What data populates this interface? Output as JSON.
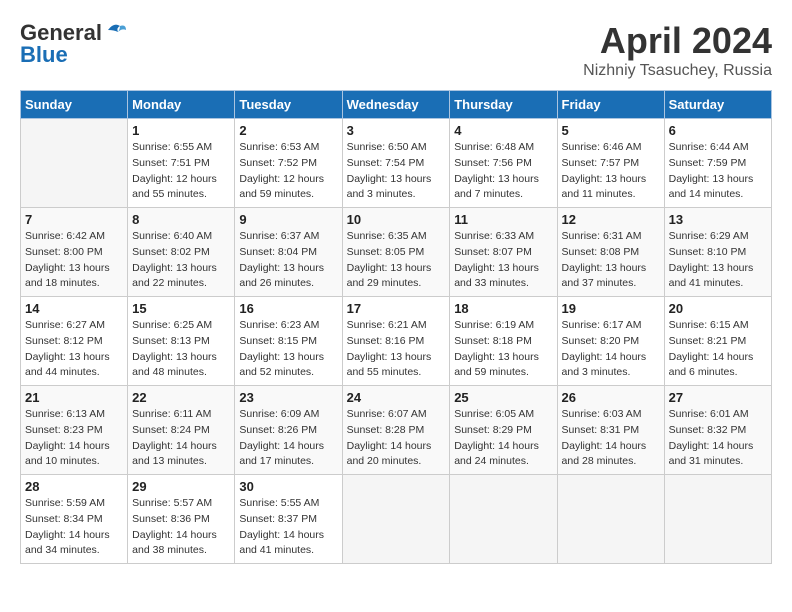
{
  "header": {
    "logo_line1": "General",
    "logo_line2": "Blue",
    "title": "April 2024",
    "subtitle": "Nizhniy Tsasuchey, Russia"
  },
  "calendar": {
    "days_of_week": [
      "Sunday",
      "Monday",
      "Tuesday",
      "Wednesday",
      "Thursday",
      "Friday",
      "Saturday"
    ],
    "weeks": [
      [
        {
          "day": "",
          "sunrise": "",
          "sunset": "",
          "daylight": ""
        },
        {
          "day": "1",
          "sunrise": "Sunrise: 6:55 AM",
          "sunset": "Sunset: 7:51 PM",
          "daylight": "Daylight: 12 hours and 55 minutes."
        },
        {
          "day": "2",
          "sunrise": "Sunrise: 6:53 AM",
          "sunset": "Sunset: 7:52 PM",
          "daylight": "Daylight: 12 hours and 59 minutes."
        },
        {
          "day": "3",
          "sunrise": "Sunrise: 6:50 AM",
          "sunset": "Sunset: 7:54 PM",
          "daylight": "Daylight: 13 hours and 3 minutes."
        },
        {
          "day": "4",
          "sunrise": "Sunrise: 6:48 AM",
          "sunset": "Sunset: 7:56 PM",
          "daylight": "Daylight: 13 hours and 7 minutes."
        },
        {
          "day": "5",
          "sunrise": "Sunrise: 6:46 AM",
          "sunset": "Sunset: 7:57 PM",
          "daylight": "Daylight: 13 hours and 11 minutes."
        },
        {
          "day": "6",
          "sunrise": "Sunrise: 6:44 AM",
          "sunset": "Sunset: 7:59 PM",
          "daylight": "Daylight: 13 hours and 14 minutes."
        }
      ],
      [
        {
          "day": "7",
          "sunrise": "Sunrise: 6:42 AM",
          "sunset": "Sunset: 8:00 PM",
          "daylight": "Daylight: 13 hours and 18 minutes."
        },
        {
          "day": "8",
          "sunrise": "Sunrise: 6:40 AM",
          "sunset": "Sunset: 8:02 PM",
          "daylight": "Daylight: 13 hours and 22 minutes."
        },
        {
          "day": "9",
          "sunrise": "Sunrise: 6:37 AM",
          "sunset": "Sunset: 8:04 PM",
          "daylight": "Daylight: 13 hours and 26 minutes."
        },
        {
          "day": "10",
          "sunrise": "Sunrise: 6:35 AM",
          "sunset": "Sunset: 8:05 PM",
          "daylight": "Daylight: 13 hours and 29 minutes."
        },
        {
          "day": "11",
          "sunrise": "Sunrise: 6:33 AM",
          "sunset": "Sunset: 8:07 PM",
          "daylight": "Daylight: 13 hours and 33 minutes."
        },
        {
          "day": "12",
          "sunrise": "Sunrise: 6:31 AM",
          "sunset": "Sunset: 8:08 PM",
          "daylight": "Daylight: 13 hours and 37 minutes."
        },
        {
          "day": "13",
          "sunrise": "Sunrise: 6:29 AM",
          "sunset": "Sunset: 8:10 PM",
          "daylight": "Daylight: 13 hours and 41 minutes."
        }
      ],
      [
        {
          "day": "14",
          "sunrise": "Sunrise: 6:27 AM",
          "sunset": "Sunset: 8:12 PM",
          "daylight": "Daylight: 13 hours and 44 minutes."
        },
        {
          "day": "15",
          "sunrise": "Sunrise: 6:25 AM",
          "sunset": "Sunset: 8:13 PM",
          "daylight": "Daylight: 13 hours and 48 minutes."
        },
        {
          "day": "16",
          "sunrise": "Sunrise: 6:23 AM",
          "sunset": "Sunset: 8:15 PM",
          "daylight": "Daylight: 13 hours and 52 minutes."
        },
        {
          "day": "17",
          "sunrise": "Sunrise: 6:21 AM",
          "sunset": "Sunset: 8:16 PM",
          "daylight": "Daylight: 13 hours and 55 minutes."
        },
        {
          "day": "18",
          "sunrise": "Sunrise: 6:19 AM",
          "sunset": "Sunset: 8:18 PM",
          "daylight": "Daylight: 13 hours and 59 minutes."
        },
        {
          "day": "19",
          "sunrise": "Sunrise: 6:17 AM",
          "sunset": "Sunset: 8:20 PM",
          "daylight": "Daylight: 14 hours and 3 minutes."
        },
        {
          "day": "20",
          "sunrise": "Sunrise: 6:15 AM",
          "sunset": "Sunset: 8:21 PM",
          "daylight": "Daylight: 14 hours and 6 minutes."
        }
      ],
      [
        {
          "day": "21",
          "sunrise": "Sunrise: 6:13 AM",
          "sunset": "Sunset: 8:23 PM",
          "daylight": "Daylight: 14 hours and 10 minutes."
        },
        {
          "day": "22",
          "sunrise": "Sunrise: 6:11 AM",
          "sunset": "Sunset: 8:24 PM",
          "daylight": "Daylight: 14 hours and 13 minutes."
        },
        {
          "day": "23",
          "sunrise": "Sunrise: 6:09 AM",
          "sunset": "Sunset: 8:26 PM",
          "daylight": "Daylight: 14 hours and 17 minutes."
        },
        {
          "day": "24",
          "sunrise": "Sunrise: 6:07 AM",
          "sunset": "Sunset: 8:28 PM",
          "daylight": "Daylight: 14 hours and 20 minutes."
        },
        {
          "day": "25",
          "sunrise": "Sunrise: 6:05 AM",
          "sunset": "Sunset: 8:29 PM",
          "daylight": "Daylight: 14 hours and 24 minutes."
        },
        {
          "day": "26",
          "sunrise": "Sunrise: 6:03 AM",
          "sunset": "Sunset: 8:31 PM",
          "daylight": "Daylight: 14 hours and 28 minutes."
        },
        {
          "day": "27",
          "sunrise": "Sunrise: 6:01 AM",
          "sunset": "Sunset: 8:32 PM",
          "daylight": "Daylight: 14 hours and 31 minutes."
        }
      ],
      [
        {
          "day": "28",
          "sunrise": "Sunrise: 5:59 AM",
          "sunset": "Sunset: 8:34 PM",
          "daylight": "Daylight: 14 hours and 34 minutes."
        },
        {
          "day": "29",
          "sunrise": "Sunrise: 5:57 AM",
          "sunset": "Sunset: 8:36 PM",
          "daylight": "Daylight: 14 hours and 38 minutes."
        },
        {
          "day": "30",
          "sunrise": "Sunrise: 5:55 AM",
          "sunset": "Sunset: 8:37 PM",
          "daylight": "Daylight: 14 hours and 41 minutes."
        },
        {
          "day": "",
          "sunrise": "",
          "sunset": "",
          "daylight": ""
        },
        {
          "day": "",
          "sunrise": "",
          "sunset": "",
          "daylight": ""
        },
        {
          "day": "",
          "sunrise": "",
          "sunset": "",
          "daylight": ""
        },
        {
          "day": "",
          "sunrise": "",
          "sunset": "",
          "daylight": ""
        }
      ]
    ]
  }
}
